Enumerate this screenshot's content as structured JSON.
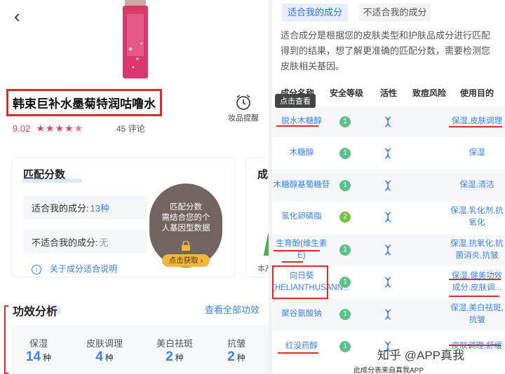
{
  "left": {
    "product_name": "韩束巨补水墨菊特润咕噜水",
    "remind_label": "妆品提醒",
    "rating": "9.02",
    "reviews": "45 评论",
    "match_card": {
      "title": "匹配分数",
      "suitable_label": "适合我的成分:",
      "suitable_value": "13种",
      "unsuitable_label": "不适合我的成分:",
      "unsuitable_value": "无",
      "help_link": "关于成分适合说明"
    },
    "overlay": {
      "line1": "匹配分数",
      "line2": "需结合您的个",
      "line3": "人基因型数据",
      "button": "点击获取 ›"
    },
    "second_card": {
      "title": "成分",
      "sub": "本产"
    },
    "efficacy": {
      "title": "功效分析",
      "view_all": "查看全部功效",
      "items": [
        {
          "label": "保湿",
          "count": "14",
          "unit": "种"
        },
        {
          "label": "皮肤调理",
          "count": "4",
          "unit": "种"
        },
        {
          "label": "美白祛斑",
          "count": "2",
          "unit": "种"
        },
        {
          "label": "抗皱",
          "count": "2",
          "unit": "种"
        }
      ]
    }
  },
  "right": {
    "tabs": [
      "适合我的成分",
      "不适合我的成分"
    ],
    "description": "适合成分是根据您的皮肤类型和护肤品成分进行匹配得到的结果，想了解更准确的匹配分数，需要检测您皮肤相关基因。",
    "headers": [
      "成分名称",
      "安全等级",
      "活性",
      "致痘风险",
      "使用目的"
    ],
    "tooltip": "点击查看",
    "rows": [
      {
        "name": "脱水木糖醇",
        "safety": "1",
        "purpose": "保湿,皮肤调理"
      },
      {
        "name": "木糖醇",
        "safety": "1",
        "purpose": "保湿"
      },
      {
        "name": "木糖醇基葡糖苷",
        "safety": "1",
        "purpose": "保湿,清洁"
      },
      {
        "name": "氢化卵磷脂",
        "safety": "2",
        "purpose": "保湿,乳化剂,抗氧化"
      },
      {
        "name": "生育酚(维生素E)",
        "safety": "1",
        "purpose": "保湿,抗氧化,抗菌消炎,抗皱"
      },
      {
        "name": "向日葵(HELIANTHUSANN...",
        "safety": "1",
        "purpose": "保湿,健美功效成分,皮肤调..."
      },
      {
        "name": "聚谷氨酸钠",
        "safety": "1",
        "purpose": "保湿,美白祛斑,抗皱"
      },
      {
        "name": "红没药醇",
        "safety": "1",
        "purpose": "皮肤调理,舒缓"
      }
    ],
    "watermark": "知乎 @APP真我",
    "footer": "此成分表来自真我APP"
  }
}
